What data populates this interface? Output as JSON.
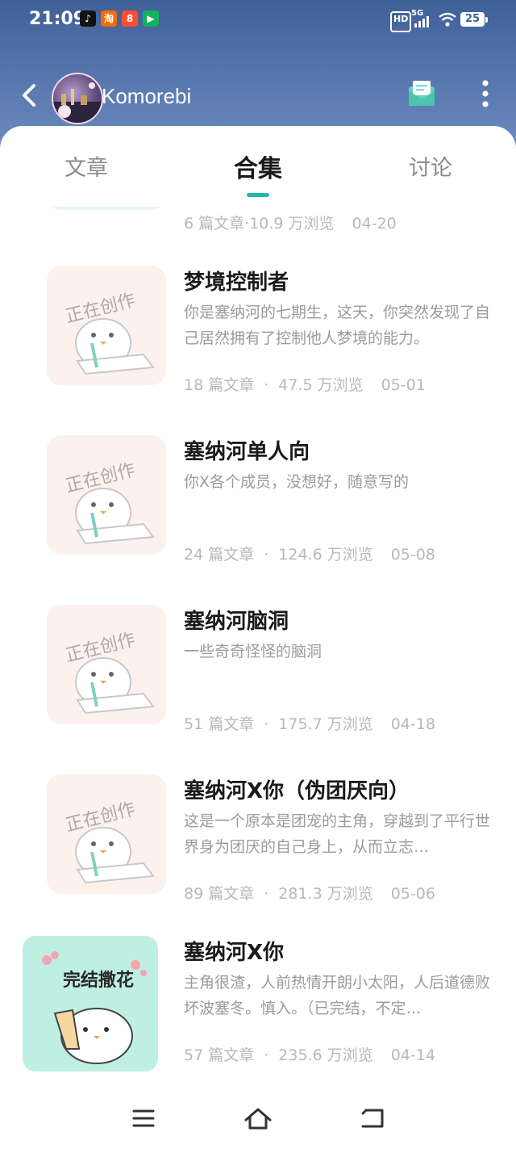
{
  "status_bar": {
    "time": "21:09",
    "icons": [
      "tiktok-icon",
      "taobao-icon",
      "app-icon",
      "video-icon"
    ],
    "signal": "5G",
    "hd": "HD",
    "battery": "25"
  },
  "header": {
    "user_name": "Komorebi",
    "icons": [
      "back-icon",
      "mail-icon",
      "more-icon"
    ]
  },
  "tabs": [
    {
      "label": "文章"
    },
    {
      "label": "合集",
      "active": true
    },
    {
      "label": "讨论"
    }
  ],
  "partial_item": {
    "meta": {
      "articles": "6 篇文章",
      "views": "10.9 万浏览",
      "date": "04-20"
    }
  },
  "collections": [
    {
      "title": "梦境控制者",
      "desc": "你是塞纳河的七期生，这天，你突然发现了自己居然拥有了控制他人梦境的能力。",
      "articles": "18 篇文章",
      "views": "47.5 万浏览",
      "date": "05-01",
      "cover": "正在创作"
    },
    {
      "title": "塞纳河单人向",
      "desc": "你X各个成员，没想好，随意写的",
      "articles": "24 篇文章",
      "views": "124.6 万浏览",
      "date": "05-08",
      "cover": "正在创作"
    },
    {
      "title": "塞纳河脑洞",
      "desc": "一些奇奇怪怪的脑洞",
      "articles": "51 篇文章",
      "views": "175.7 万浏览",
      "date": "04-18",
      "cover": "正在创作"
    },
    {
      "title": "塞纳河X你（伪团厌向）",
      "desc": "这是一个原本是团宠的主角，穿越到了平行世界身为团厌的自己身上，从而立志…",
      "articles": "89 篇文章",
      "views": "281.3 万浏览",
      "date": "05-06",
      "cover": "正在创作"
    },
    {
      "title": "塞纳河X你",
      "desc": "主角很渣，人前热情开朗小太阳，人后道德败坏波塞冬。慎入。（已完结，不定…",
      "articles": "57 篇文章",
      "views": "235.6 万浏览",
      "date": "04-14",
      "cover": "完结撒花"
    }
  ],
  "meta_separator": "·",
  "colors": {
    "header_top": "#3f5f98",
    "accent": "#22b8a8",
    "cover_wip_bg": "#fdf1ee",
    "cover_done_bg": "#bfefe3"
  },
  "bottom_nav": [
    "menu-icon",
    "home-icon",
    "back-nav-icon"
  ]
}
